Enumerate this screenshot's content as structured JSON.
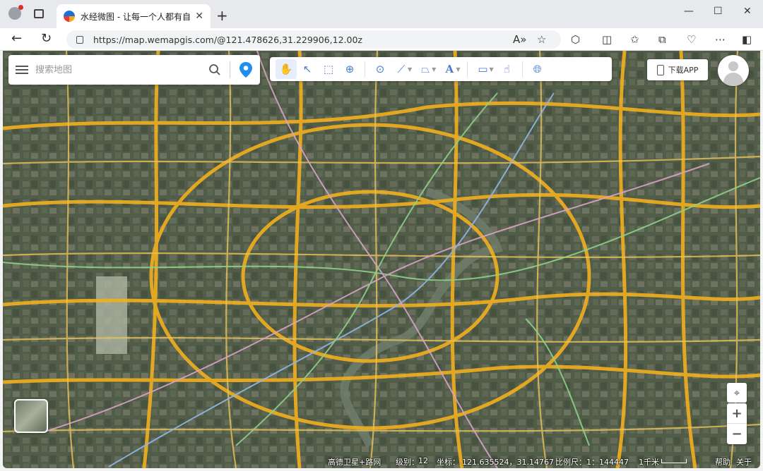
{
  "browser": {
    "tab_title": "水经微图 - 让每一个人都有自己的",
    "tab_close": "✕",
    "new_tab": "+",
    "url": "https://map.wemapgis.com/@121.478626,31.229906,12.00z",
    "window_controls": {
      "minimize": "—",
      "maximize": "☐",
      "close": "✕"
    }
  },
  "map": {
    "search_placeholder": "搜索地图",
    "download_app": "下载APP",
    "layer_name": "高德卫星+路网",
    "level_label": "级别：",
    "level_value": "12",
    "coord_label": "坐标：",
    "coord_value": "121.635524，31.14767",
    "scale_label": "比例尺：",
    "scale_value": "1：144447",
    "scale_bar_label": "1千米",
    "help": "帮助",
    "about": "关于",
    "zoom_in": "+",
    "zoom_out": "−"
  },
  "colors": {
    "road_major": "#f2b01e",
    "road_minor": "#e9c35a",
    "metro_pink": "#d9a3c8",
    "metro_green": "#8fd18a",
    "metro_blue": "#8fb6e6",
    "river": "#6f7d6a",
    "accent": "#1e8ef0"
  }
}
